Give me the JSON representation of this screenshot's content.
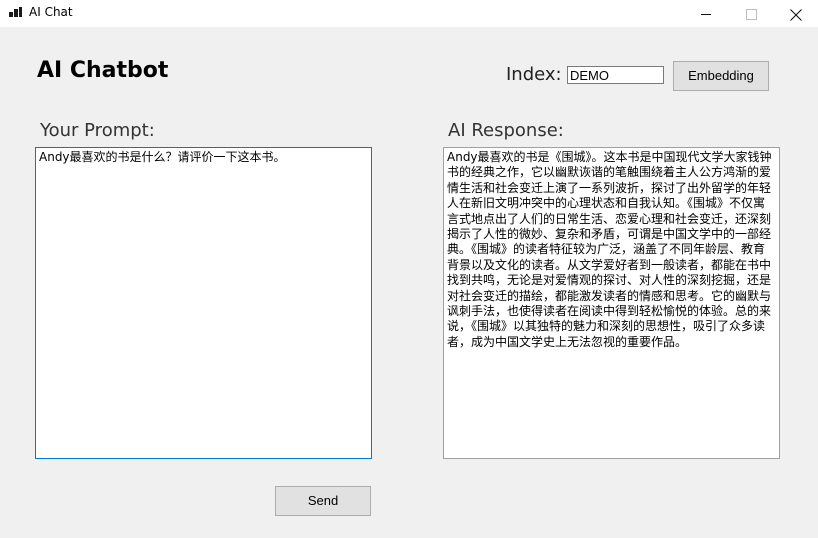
{
  "window": {
    "title": "AI Chat",
    "controls": {
      "minimize_icon": "minimize-icon",
      "maximize_icon": "maximize-icon",
      "close_icon": "close-icon"
    }
  },
  "header": {
    "title": "AI Chatbot",
    "index_label": "Index:",
    "index_value": "DEMO",
    "embedding_button": "Embedding"
  },
  "prompt": {
    "label": "Your Prompt:",
    "text": "Andy最喜欢的书是什么？请评价一下这本书。"
  },
  "response": {
    "label": "AI Response:",
    "text": "Andy最喜欢的书是《围城》。这本书是中国现代文学大家钱钟书的经典之作，它以幽默诙谐的笔触围绕着主人公方鸿渐的爱情生活和社会变迁上演了一系列波折，探讨了出外留学的年轻人在新旧文明冲突中的心理状态和自我认知。《围城》不仅寓言式地点出了人们的日常生活、恋爱心理和社会变迁，还深刻揭示了人性的微妙、复杂和矛盾，可谓是中国文学中的一部经典。《围城》的读者特征较为广泛，涵盖了不同年龄层、教育背景以及文化的读者。从文学爱好者到一般读者，都能在书中找到共鸣，无论是对爱情观的探讨、对人性的深刻挖掘，还是对社会变迁的描绘，都能激发读者的情感和思考。它的幽默与讽刺手法，也使得读者在阅读中得到轻松愉悦的体验。总的来说，《围城》以其独特的魅力和深刻的思想性，吸引了众多读者，成为中国文学史上无法忽视的重要作品。"
  },
  "actions": {
    "send_button": "Send"
  },
  "colors": {
    "window_bg": "#f0f0f0",
    "titlebar_bg": "#ffffff",
    "focus_border": "#0078d7",
    "button_bg": "#e1e1e1"
  }
}
